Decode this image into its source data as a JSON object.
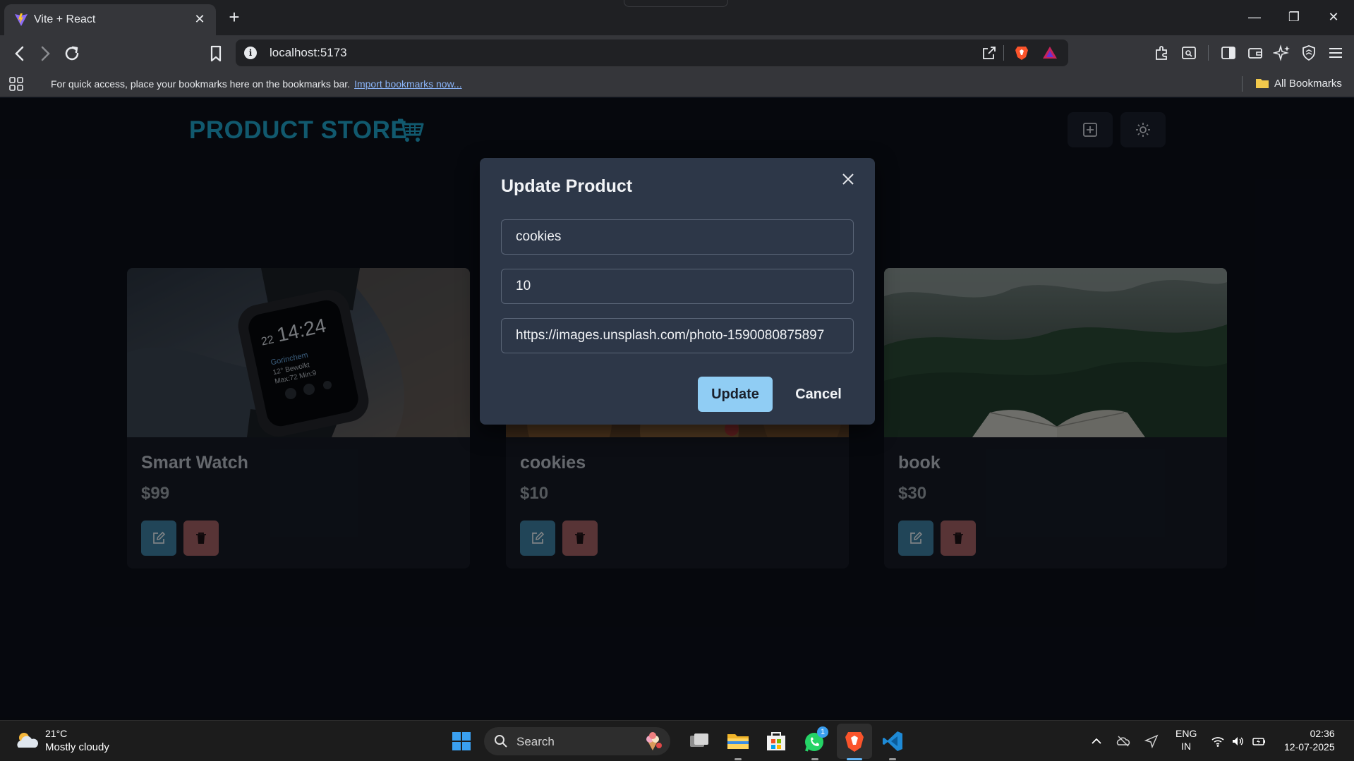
{
  "browser": {
    "tab_title": "Vite + React",
    "url": "localhost:5173",
    "bookmarks_prompt": "For quick access, place your bookmarks here on the bookmarks bar.",
    "bookmarks_link": "Import bookmarks now...",
    "all_bookmarks": "All Bookmarks"
  },
  "app": {
    "brand": "PRODUCT STORE",
    "brand_color": "#1fa3c9",
    "products": [
      {
        "name": "Smart Watch",
        "price": "$99"
      },
      {
        "name": "cookies",
        "price": "$10"
      },
      {
        "name": "book",
        "price": "$30"
      }
    ]
  },
  "modal": {
    "title": "Update Product",
    "name_value": "cookies",
    "price_value": "10",
    "image_value": "https://images.unsplash.com/photo-1590080875897",
    "update_label": "Update",
    "cancel_label": "Cancel",
    "accent": "#90cdf4"
  },
  "taskbar": {
    "temperature": "21°C",
    "weather": "Mostly cloudy",
    "search_label": "Search",
    "whatsapp_badge": "1",
    "lang_top": "ENG",
    "lang_bottom": "IN",
    "time": "02:36",
    "date": "12-07-2025"
  }
}
